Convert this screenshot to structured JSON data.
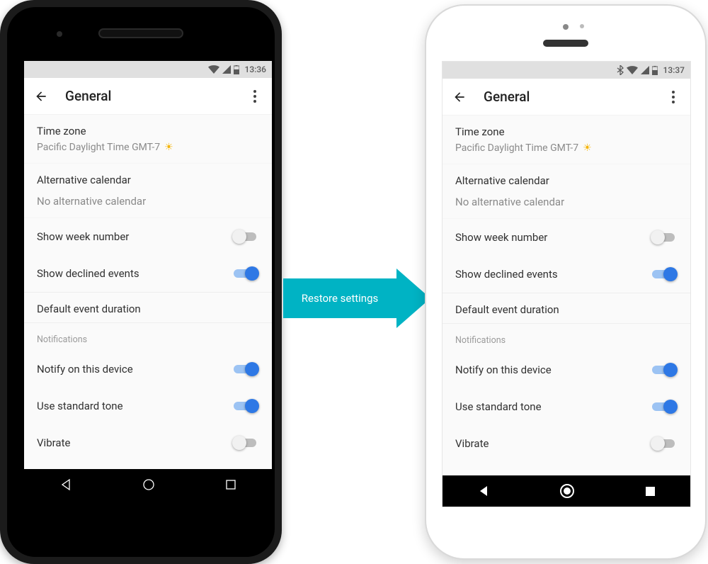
{
  "arrow": {
    "label": "Restore settings",
    "color": "#00b3c4"
  },
  "phone1": {
    "status": {
      "time": "13:36",
      "bluetooth": false
    },
    "appbar": {
      "title": "General"
    },
    "rows": {
      "timezone": {
        "label": "Time zone",
        "value": "Pacific Daylight Time  GMT-7"
      },
      "altcal": {
        "label": "Alternative calendar",
        "value": "No alternative calendar"
      },
      "weeknum": {
        "label": "Show week number",
        "on": false
      },
      "declined": {
        "label": "Show declined events",
        "on": true
      },
      "duration": {
        "label": "Default event duration"
      },
      "notif_header": "Notifications",
      "notify": {
        "label": "Notify on this device",
        "on": true
      },
      "tone": {
        "label": "Use standard tone",
        "on": true
      },
      "vibrate": {
        "label": "Vibrate",
        "on": false
      }
    }
  },
  "phone2": {
    "status": {
      "time": "13:37",
      "bluetooth": true
    },
    "appbar": {
      "title": "General"
    },
    "rows": {
      "timezone": {
        "label": "Time zone",
        "value": "Pacific Daylight Time  GMT-7"
      },
      "altcal": {
        "label": "Alternative calendar",
        "value": "No alternative calendar"
      },
      "weeknum": {
        "label": "Show week number",
        "on": false
      },
      "declined": {
        "label": "Show declined events",
        "on": true
      },
      "duration": {
        "label": "Default event duration"
      },
      "notif_header": "Notifications",
      "notify": {
        "label": "Notify on this device",
        "on": true
      },
      "tone": {
        "label": "Use standard tone",
        "on": true
      },
      "vibrate": {
        "label": "Vibrate",
        "on": false
      }
    }
  }
}
